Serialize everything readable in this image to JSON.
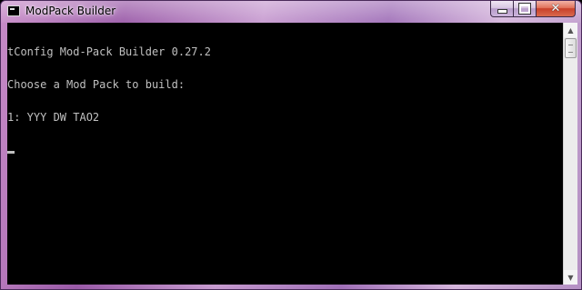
{
  "window": {
    "title": "ModPack Builder",
    "icon": "console-icon"
  },
  "caption_buttons": {
    "minimize_icon": "minimize-icon",
    "maximize_icon": "maximize-icon",
    "close_glyph": "✕"
  },
  "console": {
    "lines": [
      "tConfig Mod-Pack Builder 0.27.2",
      "Choose a Mod Pack to build:",
      "1: YYY DW TAO2"
    ],
    "cursor": "_"
  },
  "scrollbar": {
    "up_arrow": "▲",
    "down_arrow": "▼"
  },
  "colors": {
    "console_background": "#000000",
    "console_text": "#c0c0c0",
    "frame_accent": "#b07ac0",
    "close_button": "#c8402a"
  }
}
